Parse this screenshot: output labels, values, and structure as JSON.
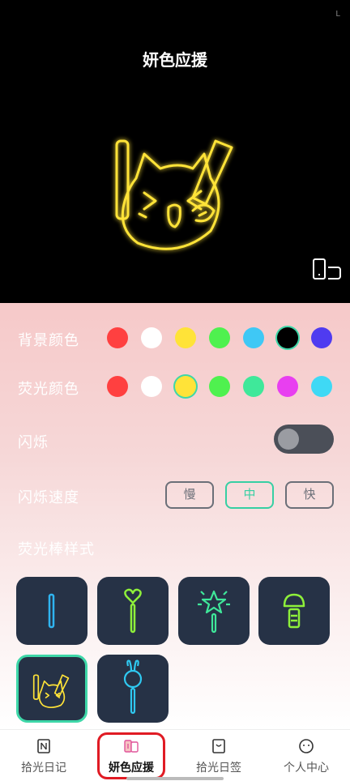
{
  "header": {
    "title": "妍色应援",
    "status_mark": "L"
  },
  "settings": {
    "background_color": {
      "label": "背景颜色",
      "colors": [
        "#ff4040",
        "#ffffff",
        "#ffe338",
        "#4ff14f",
        "#3fc8f5",
        "#000000",
        "#4f3bf0"
      ],
      "selected_index": 5
    },
    "glow_color": {
      "label": "荧光颜色",
      "colors": [
        "#ff4040",
        "#ffffff",
        "#ffe338",
        "#4ff14f",
        "#3fe89a",
        "#e83ff0",
        "#3fd9f5"
      ],
      "selected_index": 2
    },
    "blink": {
      "label": "闪烁",
      "enabled": false
    },
    "blink_speed": {
      "label": "闪烁速度",
      "options": [
        "慢",
        "中",
        "快"
      ],
      "selected_index": 1
    },
    "stick_style": {
      "label": "荧光棒样式",
      "styles": [
        "line-stick",
        "heart-wand",
        "star-wand",
        "mic-stick",
        "cat-face",
        "bunny-stick"
      ],
      "selected_index": 4
    }
  },
  "nav": {
    "items": [
      {
        "label": "拾光日记",
        "icon": "notebook-icon"
      },
      {
        "label": "妍色应援",
        "icon": "lightstick-icon"
      },
      {
        "label": "拾光日签",
        "icon": "card-icon"
      },
      {
        "label": "个人中心",
        "icon": "face-icon"
      }
    ],
    "active_index": 1
  },
  "colors": {
    "accent": "#3ed7a8",
    "glow": "#ffe338",
    "highlight": "#e01b24"
  }
}
